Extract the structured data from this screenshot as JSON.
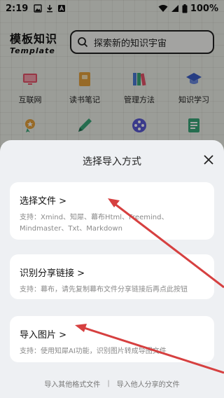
{
  "status_bar": {
    "time": "2:19",
    "battery": "100%"
  },
  "header": {
    "logo_title": "模板知识",
    "logo_subtitle": "Template",
    "search_placeholder": "探索新的知识宇宙"
  },
  "categories": [
    {
      "label": "互联网",
      "icon": "monitor-icon",
      "color": "#e8546b"
    },
    {
      "label": "读书笔记",
      "icon": "book-icon",
      "color": "#e8a33c"
    },
    {
      "label": "管理方法",
      "icon": "books-icon",
      "color": "#4a7bd6"
    },
    {
      "label": "知识学习",
      "icon": "graduation-cap-icon",
      "color": "#3b5fc9"
    },
    {
      "label": "",
      "icon": "award-icon",
      "color": "#e8a33c"
    },
    {
      "label": "",
      "icon": "pen-icon",
      "color": "#3aa87a"
    },
    {
      "label": "",
      "icon": "film-reel-icon",
      "color": "#5a5ad6"
    },
    {
      "label": "",
      "icon": "notes-icon",
      "color": "#3aa87a"
    }
  ],
  "sheet": {
    "title": "选择导入方式",
    "options": [
      {
        "title": "选择文件 >",
        "desc": "支持：Xmind、知犀、幕布Html、Freemind、Mindmaster、Txt、Markdown"
      },
      {
        "title": "识别分享链接 >",
        "desc": "支持：幕布，请先复制幕布文件分享链接后再点此按钮"
      },
      {
        "title": "导入图片 >",
        "desc": "支持：使用知犀AI功能，识别图片转成导图文件"
      }
    ],
    "footer_links": [
      "导入其他格式文件",
      "导入他人分享的文件"
    ]
  },
  "colors": {
    "annotation_arrow": "#d64040",
    "sheet_background": "#eef0f3"
  }
}
